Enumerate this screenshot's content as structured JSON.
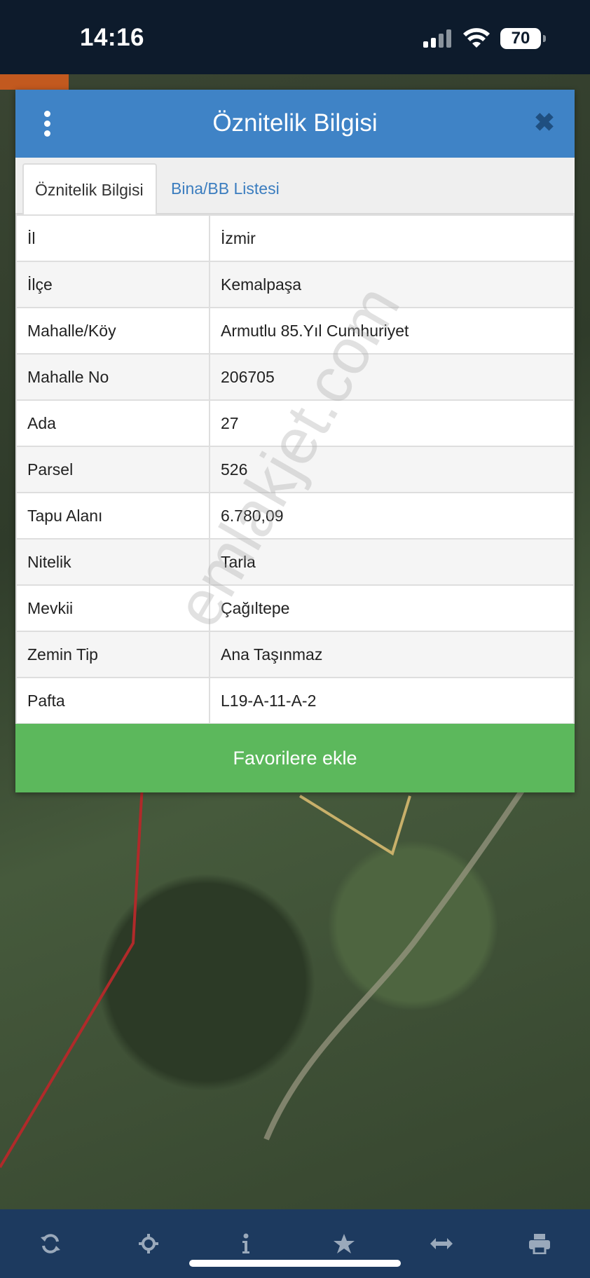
{
  "status_bar": {
    "time": "14:16",
    "battery": "70",
    "icons": [
      "signal-icon",
      "wifi-icon",
      "battery-icon"
    ]
  },
  "dialog": {
    "title": "Öznitelik Bilgisi",
    "menu_icon": "kebab-menu-icon",
    "close_icon": "close-icon",
    "tabs": [
      {
        "label": "Öznitelik Bilgisi",
        "active": true
      },
      {
        "label": "Bina/BB Listesi",
        "active": false
      }
    ],
    "rows": [
      {
        "key": "İl",
        "value": "İzmir"
      },
      {
        "key": "İlçe",
        "value": "Kemalpaşa"
      },
      {
        "key": "Mahalle/Köy",
        "value": "Armutlu 85.Yıl Cumhuriyet"
      },
      {
        "key": "Mahalle No",
        "value": "206705"
      },
      {
        "key": "Ada",
        "value": "27"
      },
      {
        "key": "Parsel",
        "value": "526"
      },
      {
        "key": "Tapu Alanı",
        "value": "6.780,09"
      },
      {
        "key": "Nitelik",
        "value": "Tarla"
      },
      {
        "key": "Mevkii",
        "value": "Çağıltepe"
      },
      {
        "key": "Zemin Tip",
        "value": "Ana Taşınmaz"
      },
      {
        "key": "Pafta",
        "value": "L19-A-11-A-2"
      }
    ],
    "favorite_button": "Favorilere ekle"
  },
  "watermark": "emlakjet.com",
  "toolbar": {
    "items": [
      "refresh-icon",
      "locate-icon",
      "info-icon",
      "star-icon",
      "measure-icon",
      "print-icon"
    ]
  },
  "colors": {
    "header_blue": "#3f83c6",
    "favorite_green": "#5cb85c",
    "toolbar_navy": "#1d3a5f",
    "parcel_line_red": "#b02a2a"
  }
}
